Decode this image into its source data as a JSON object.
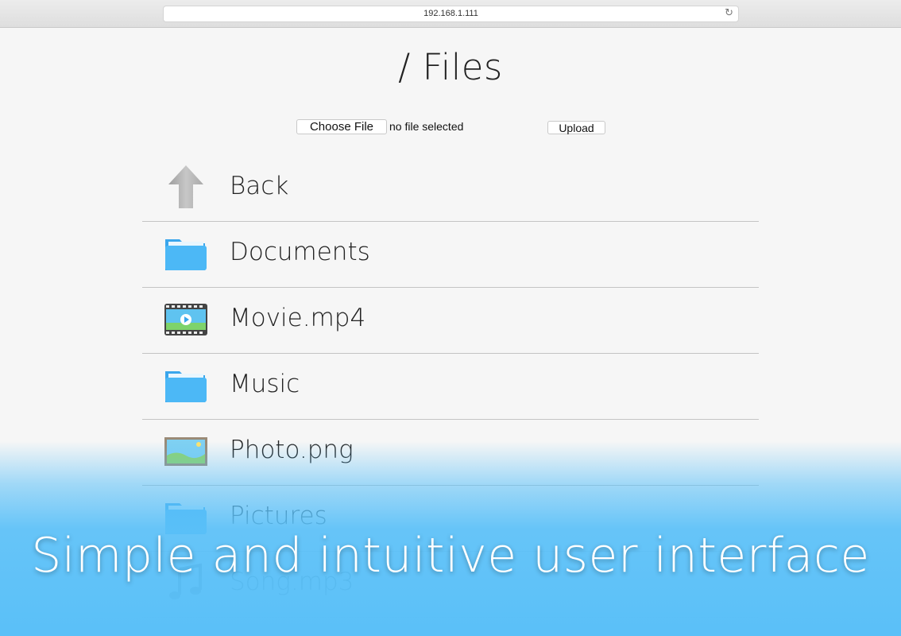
{
  "browser": {
    "url": "192.168.1.111",
    "reload_icon": "reload-icon"
  },
  "page": {
    "title": "/ Files"
  },
  "upload": {
    "choose_label": "Choose File",
    "status": "no file selected",
    "upload_label": "Upload"
  },
  "items": [
    {
      "label": "Back",
      "icon": "up-arrow-icon"
    },
    {
      "label": "Documents",
      "icon": "folder-icon"
    },
    {
      "label": "Movie.mp4",
      "icon": "video-file-icon"
    },
    {
      "label": "Music",
      "icon": "folder-icon"
    },
    {
      "label": "Photo.png",
      "icon": "image-file-icon"
    },
    {
      "label": "Pictures",
      "icon": "folder-icon"
    },
    {
      "label": "Song.mp3",
      "icon": "music-file-icon"
    }
  ],
  "overlay": {
    "tagline": "Simple and intuitive user interface"
  },
  "colors": {
    "accent_blue": "#5ac0f8",
    "folder_blue": "#4db3f5"
  }
}
